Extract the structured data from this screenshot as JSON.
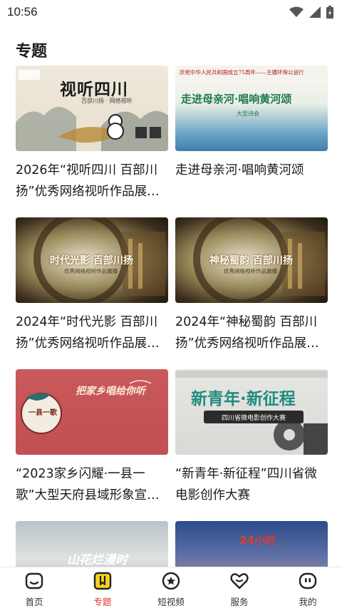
{
  "status_bar": {
    "time": "10:56"
  },
  "page": {
    "title": "专题"
  },
  "cards": [
    {
      "title": "2026年“视听四川 百部川扬”优秀网络视听作品展…",
      "image_text": "视听四川",
      "image_subtext": "百部川扬 · 网络视听"
    },
    {
      "title": "走进母亲河·唱响黄河颂",
      "image_text": "走进母亲河·唱响黄河颂",
      "image_subtext": "大型诗会",
      "image_header": "庆祝中华人民共和国成立75周年——主播环保公益行"
    },
    {
      "title": "2024年“时代光影 百部川扬”优秀网络视听作品展…",
      "image_text": "时代光影 百部川扬",
      "image_subtext": "优秀网络视听作品展播"
    },
    {
      "title": "2024年“神秘蜀韵 百部川扬”优秀网络视听作品展…",
      "image_text": "神秘蜀韵 百部川扬",
      "image_subtext": "优秀网络视听作品展播"
    },
    {
      "title": "“2023家乡闪耀·一县一歌”大型天府县域形象宣…",
      "image_text": "把家乡唱给你听",
      "image_subtext": "一县一歌"
    },
    {
      "title": "“新青年·新征程”四川省微电影创作大赛",
      "image_text": "新青年·新征程",
      "image_subtext": "四川省微电影创作大赛"
    },
    {
      "title": "",
      "image_text": "山花烂漫时"
    },
    {
      "title": "",
      "image_text": "24小时"
    }
  ],
  "nav": [
    {
      "label": "首页",
      "icon": "home-icon"
    },
    {
      "label": "专题",
      "icon": "topic-icon"
    },
    {
      "label": "短视频",
      "icon": "short-video-icon"
    },
    {
      "label": "服务",
      "icon": "service-heart-icon"
    },
    {
      "label": "我的",
      "icon": "profile-icon"
    }
  ],
  "colors": {
    "accent": "#e0332b",
    "active_icon_bg": "#f7d21a"
  }
}
